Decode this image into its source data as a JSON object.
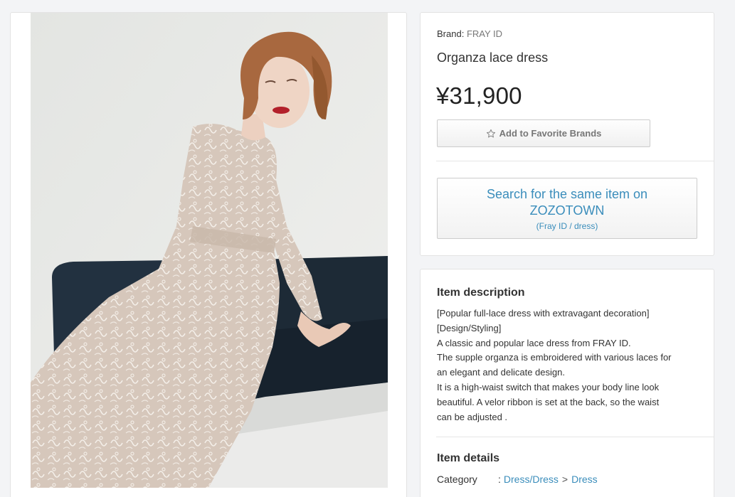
{
  "product": {
    "brand_label": "Brand:",
    "brand_name": "FRAY ID",
    "title": "Organza lace dress",
    "price": "¥31,900",
    "favorite_button": "Add to Favorite Brands",
    "favorite_icon": "star-icon",
    "zozo_search_label": "Search for the same item on ZOZOTOWN",
    "zozo_search_sub": "(Fray ID / dress)"
  },
  "description": {
    "title": "Item description",
    "lines": [
      "[Popular full-lace dress with extravagant decoration]",
      "[Design/Styling]",
      "A classic and popular lace dress from FRAY ID.",
      "The supple organza is embroidered with various laces for",
      "an elegant and delicate design.",
      "It is a high-waist switch that makes your body line look",
      "beautiful. A velor ribbon is set at the back, so the waist",
      "can be adjusted ."
    ]
  },
  "details": {
    "title": "Item details",
    "category_label": "Category",
    "category_colon": ":",
    "category_path_1": "Dress/Dress",
    "category_sep": ">",
    "category_path_2": "Dress"
  },
  "colors": {
    "link": "#3a8dbb",
    "sofa": "#1d2a36",
    "dress": "#d8c9bd",
    "background": "#f3f4f6"
  }
}
